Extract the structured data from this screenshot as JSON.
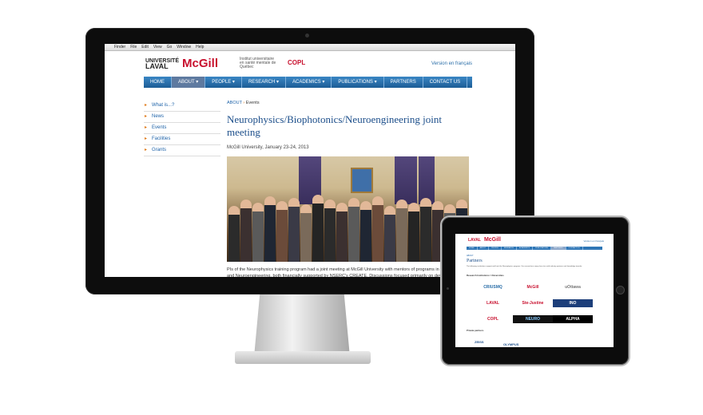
{
  "menubar": {
    "items": [
      "Finder",
      "File",
      "Edit",
      "View",
      "Go",
      "Window",
      "Help"
    ]
  },
  "site": {
    "logos": {
      "laval_top": "UNIVERSITÉ",
      "laval_bottom": "LAVAL",
      "mcgill": "McGill",
      "fr_partner": "Institut universitaire en santé mentale de Québec",
      "copl": "COPL"
    },
    "lang_link": "Version en français",
    "nav": [
      "HOME",
      "ABOUT ▾",
      "PEOPLE ▾",
      "RESEARCH ▾",
      "ACADEMICS ▾",
      "PUBLICATIONS ▾",
      "PARTNERS",
      "CONTACT US"
    ],
    "sidebar": [
      "What is...?",
      "News",
      "Events",
      "Facilities",
      "Grants"
    ],
    "breadcrumb": {
      "parent": "ABOUT",
      "sep": "›",
      "current": "Events"
    },
    "title": "Neurophysics/Biophotonics/Neuroengineering joint meeting",
    "date": "McGill University, January 23-24, 2013",
    "body": "PIs of the Neurophysics training program had a joint meeting at McGill University with mentors of programs in Biophotonics and Neuroengineering, both financially supported by NSERC's CREATE. Discussions focused primarily on developing new collaborations amongst the 3 groups, as well as b"
  },
  "ipad": {
    "head_laval": "LAVAL",
    "head_mcgill": "McGill",
    "lang": "Version en français",
    "nav": [
      "HOME",
      "ABOUT",
      "PEOPLE",
      "RESEARCH",
      "ACADEMICS",
      "PUBLICATIONS",
      "PARTNERS",
      "CONTACT US"
    ],
    "crumb": "ABOUT",
    "title": "Partners",
    "intro": "The following institutions support and host the Neurophysics program. Our researchers enjoy close ties with industry partners and knowledge transfer.",
    "section1": "Research Institutions / Universities",
    "logos": [
      "CRIUSMQ",
      "McGill",
      "uOttawa",
      "LAVAL",
      "Ste-Justine",
      "INO",
      "COPL",
      "NEURO",
      "ALPHA"
    ],
    "section2": "Private partners",
    "partner_a": "ZEISS",
    "partner_b": "OLYMPUS"
  },
  "colors": {
    "nav": "#2a70b0",
    "title": "#1d4f8b",
    "brand_red": "#c8102e",
    "bezel": "#0d0d0d"
  }
}
